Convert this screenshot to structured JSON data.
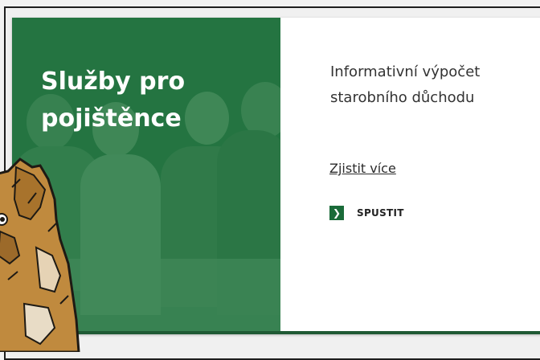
{
  "card": {
    "hero_title": "Služby pro pojištěnce",
    "subtitle": "Informativní výpočet starobního důchodu",
    "more_link": "Zjistit více",
    "launch_label": "SPUSTIT"
  },
  "colors": {
    "brand_green": "#1a6b39",
    "hero_overlay": "#2f7d4b",
    "card_border": "#1f5a34"
  },
  "icons": [
    "chevron-right-icon"
  ]
}
